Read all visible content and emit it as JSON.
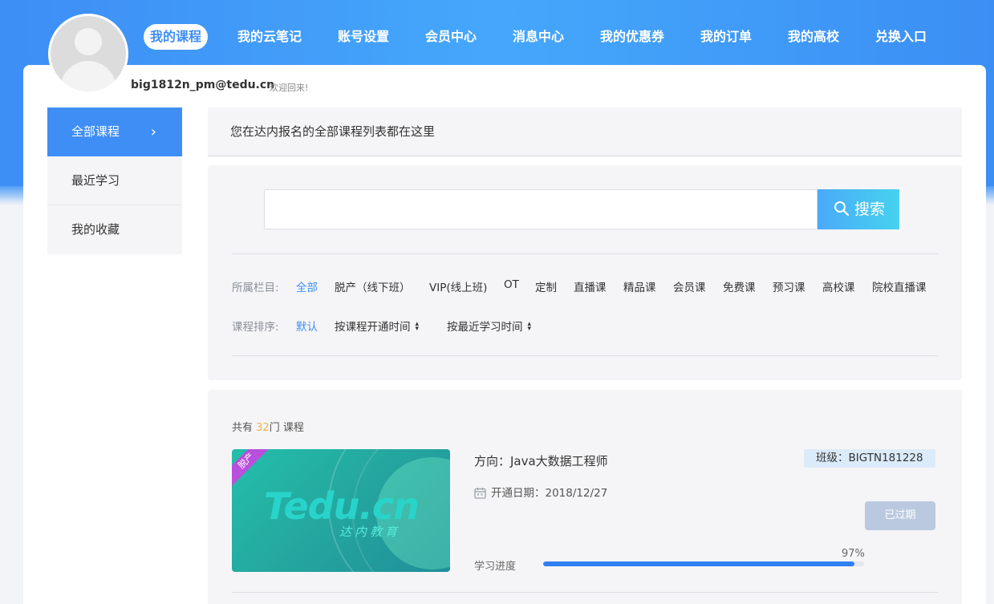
{
  "nav": {
    "items": [
      {
        "label": "我的课程",
        "active": true
      },
      {
        "label": "我的云笔记"
      },
      {
        "label": "账号设置"
      },
      {
        "label": "会员中心"
      },
      {
        "label": "消息中心"
      },
      {
        "label": "我的优惠券"
      },
      {
        "label": "我的订单"
      },
      {
        "label": "我的高校"
      },
      {
        "label": "兑换入口"
      }
    ]
  },
  "user": {
    "email": "big1812n_pm@tedu.cn",
    "greeting": "欢迎回来!"
  },
  "sidebar": {
    "items": [
      {
        "label": "全部课程",
        "chevron": "›",
        "active": true
      },
      {
        "label": "最近学习"
      },
      {
        "label": "我的收藏"
      }
    ]
  },
  "panel": {
    "title": "您在达内报名的全部课程列表都在这里"
  },
  "search": {
    "placeholder": "",
    "value": "",
    "button_label": "搜索"
  },
  "filters": {
    "category_label": "所属栏目:",
    "categories": [
      "全部",
      "脱产（线下班）",
      "VIP(线上班)",
      "OT",
      "定制",
      "直播课",
      "精品课",
      "会员课",
      "免费课",
      "预习课",
      "高校课",
      "院校直播课"
    ],
    "sort_label": "课程排序:",
    "sorts": [
      "默认",
      "按课程开通时间",
      "按最近学习时间"
    ],
    "sort_arrow": "▲▼"
  },
  "list": {
    "count_prefix": "共有",
    "count": "32",
    "count_unit": "门",
    "count_suffix": "课程"
  },
  "course": {
    "thumb_logo": "Tedu.cn",
    "thumb_sub": "达内教育",
    "ribbon": "脱产",
    "direction": "方向：Java大数据工程师",
    "class_label": "班级：BIGTN181228",
    "open_date": "开通日期：2018/12/27",
    "status_button": "已过期",
    "progress_label": "学习进度",
    "progress_text": "97%",
    "progress_value": 0.97
  },
  "colors": {
    "accent": "#3f8ef5",
    "header_gradient_start": "#3d8ef5",
    "search_gradient_end": "#46d2ee",
    "count_highlight": "#f0b54a",
    "expired": "#bac9e0",
    "ribbon": "#b94fdd"
  }
}
